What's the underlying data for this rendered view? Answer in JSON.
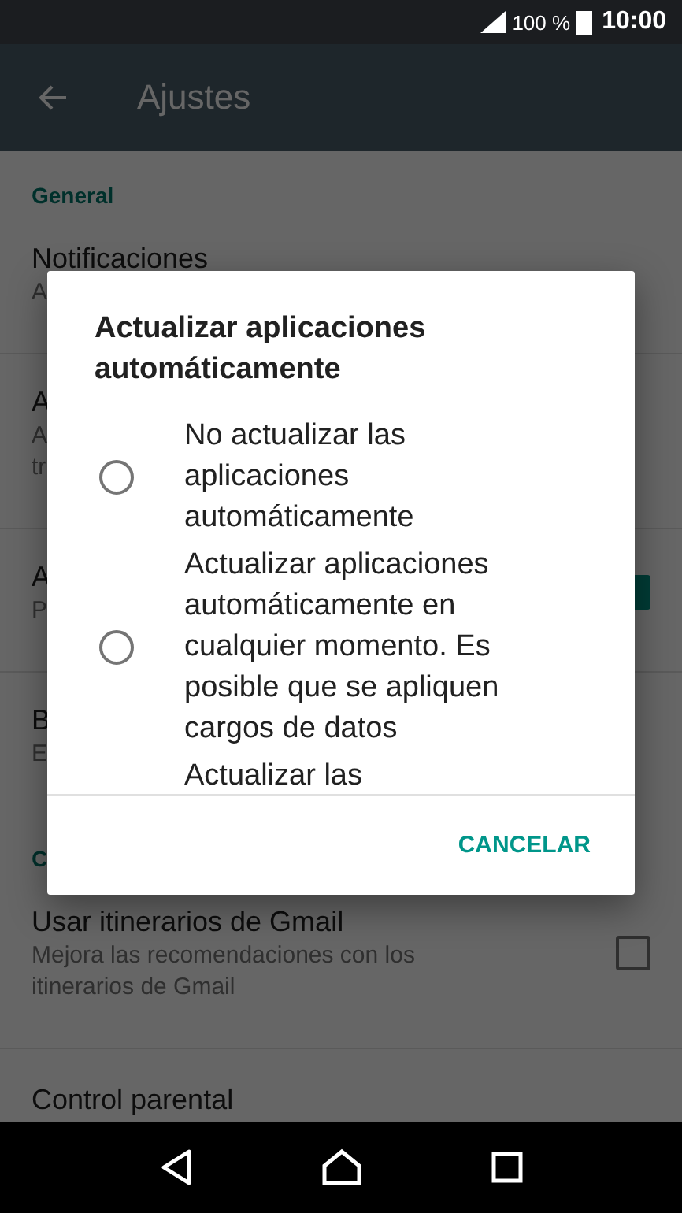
{
  "status_bar": {
    "battery": "100 %",
    "time": "10:00"
  },
  "app_bar": {
    "title": "Ajustes"
  },
  "settings": [
    {
      "kind": "header",
      "text": "General"
    },
    {
      "kind": "item",
      "title": "Notificaciones",
      "subtitle": [
        "A"
      ]
    },
    {
      "kind": "item",
      "title": "A",
      "subtitle": [
        "A",
        "tr"
      ]
    },
    {
      "kind": "item",
      "title": "A",
      "subtitle": [
        "P"
      ],
      "checked": true
    },
    {
      "kind": "item",
      "title": "B",
      "subtitle": [
        "E"
      ]
    },
    {
      "kind": "header",
      "text": "C"
    },
    {
      "kind": "item",
      "title": "Usar itinerarios de Gmail",
      "subtitle": [
        "Mejora las recomendaciones con los itinerarios de Gmail"
      ],
      "checked": false
    },
    {
      "kind": "item",
      "title": "Control parental"
    }
  ],
  "dialog": {
    "title": "Actualizar aplicaciones automáticamente",
    "options": [
      {
        "label": "No actualizar las aplicaciones automáticamente",
        "selected": false
      },
      {
        "label": "Actualizar aplicaciones automáticamente en cualquier momento. Es posible que se apliquen cargos de datos",
        "selected": false
      },
      {
        "label": "Actualizar las"
      }
    ],
    "buttons": [
      "CANCELAR"
    ]
  }
}
